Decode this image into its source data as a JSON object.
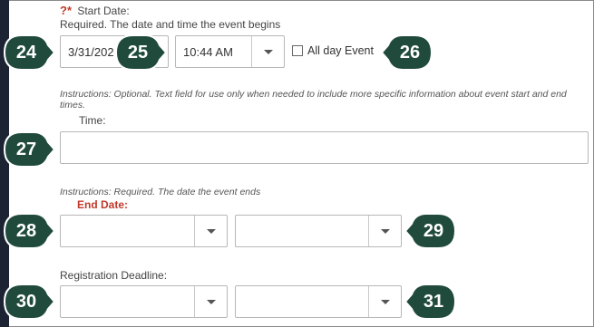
{
  "start_date": {
    "marker": "?*",
    "label": "Start Date:",
    "help": "Required. The date and time the event begins",
    "date_value": "3/31/202",
    "time_value": "10:44 AM",
    "all_day_label": "All day Event"
  },
  "time_field": {
    "instructions": "Instructions: Optional. Text field for use only when needed to include more specific information about event start and end times.",
    "label": "Time:",
    "value": ""
  },
  "end_date": {
    "instructions": "Instructions: Required. The date the event ends",
    "label": "End Date:",
    "date_value": "",
    "time_value": ""
  },
  "registration": {
    "label": "Registration Deadline:",
    "date_value": "",
    "time_value": ""
  },
  "callouts": [
    "24",
    "25",
    "26",
    "27",
    "28",
    "29",
    "30",
    "31"
  ],
  "colors": {
    "callout": "#1f4a3c",
    "required": "#c0392b",
    "left_bar": "#1c2433"
  }
}
